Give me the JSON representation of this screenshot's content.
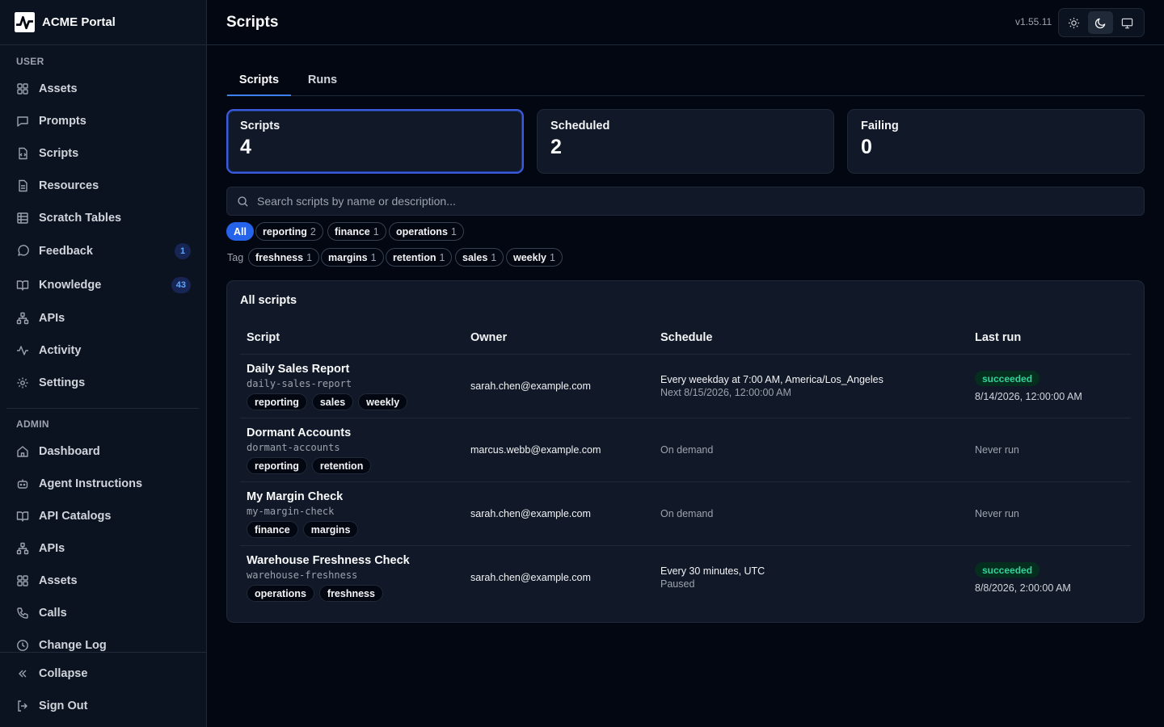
{
  "brand": {
    "name": "ACME Portal",
    "logo_icon": "pulse-logo-icon"
  },
  "sidebar": {
    "user_label": "USER",
    "user_items": [
      {
        "label": "Assets",
        "icon": "grid-icon"
      },
      {
        "label": "Prompts",
        "icon": "message-square-icon"
      },
      {
        "label": "Scripts",
        "icon": "file-code-icon"
      },
      {
        "label": "Resources",
        "icon": "file-icon"
      },
      {
        "label": "Scratch Tables",
        "icon": "table-icon"
      },
      {
        "label": "Feedback",
        "icon": "message-circle-icon",
        "badge": "1"
      },
      {
        "label": "Knowledge",
        "icon": "book-open-icon",
        "badge": "43"
      },
      {
        "label": "APIs",
        "icon": "network-icon"
      },
      {
        "label": "Activity",
        "icon": "activity-icon"
      },
      {
        "label": "Settings",
        "icon": "gear-icon"
      }
    ],
    "admin_label": "ADMIN",
    "admin_items": [
      {
        "label": "Dashboard",
        "icon": "home-icon"
      },
      {
        "label": "Agent Instructions",
        "icon": "bot-icon"
      },
      {
        "label": "API Catalogs",
        "icon": "book-open-icon"
      },
      {
        "label": "APIs",
        "icon": "network-icon"
      },
      {
        "label": "Assets",
        "icon": "grid-icon"
      },
      {
        "label": "Calls",
        "icon": "phone-icon"
      },
      {
        "label": "Change Log",
        "icon": "clock-icon"
      }
    ],
    "collapse_label": "Collapse",
    "signout_label": "Sign Out"
  },
  "header": {
    "title": "Scripts",
    "version": "v1.55.11",
    "theme_options": [
      "light-sun-icon",
      "dark-moon-icon",
      "system-monitor-icon"
    ],
    "active_theme": "dark"
  },
  "tabs": [
    {
      "label": "Scripts",
      "active": true
    },
    {
      "label": "Runs",
      "active": false
    }
  ],
  "stats": [
    {
      "label": "Scripts",
      "value": "4"
    },
    {
      "label": "Scheduled",
      "value": "2"
    },
    {
      "label": "Failing",
      "value": "0"
    }
  ],
  "search": {
    "placeholder": "Search scripts by name or description...",
    "value": ""
  },
  "filters": {
    "all_label": "All",
    "row1": [
      {
        "label": "reporting",
        "count": "2"
      },
      {
        "label": "finance",
        "count": "1"
      },
      {
        "label": "operations",
        "count": "1"
      }
    ],
    "tag_label": "Tag",
    "row2": [
      {
        "label": "freshness",
        "count": "1"
      },
      {
        "label": "margins",
        "count": "1"
      },
      {
        "label": "retention",
        "count": "1"
      },
      {
        "label": "sales",
        "count": "1"
      },
      {
        "label": "weekly",
        "count": "1"
      }
    ]
  },
  "table": {
    "title": "All scripts",
    "columns": [
      "Script",
      "Owner",
      "Schedule",
      "Last run"
    ],
    "rows": [
      {
        "name": "Daily Sales Report",
        "slug": "daily-sales-report",
        "tags": [
          "reporting",
          "sales",
          "weekly"
        ],
        "owner": "sarah.chen@example.com",
        "schedule": "Every weekday at 7:00 AM, America/Los_Angeles",
        "schedule_sub": "Next 8/15/2026, 12:00:00 AM",
        "last_status": "succeeded",
        "last_time": "8/14/2026, 12:00:00 AM"
      },
      {
        "name": "Dormant Accounts",
        "slug": "dormant-accounts",
        "tags": [
          "reporting",
          "retention"
        ],
        "owner": "marcus.webb@example.com",
        "schedule": "On demand",
        "schedule_sub": "",
        "last_status": "",
        "last_time": "Never run"
      },
      {
        "name": "My Margin Check",
        "slug": "my-margin-check",
        "tags": [
          "finance",
          "margins"
        ],
        "owner": "sarah.chen@example.com",
        "schedule": "On demand",
        "schedule_sub": "",
        "last_status": "",
        "last_time": "Never run"
      },
      {
        "name": "Warehouse Freshness Check",
        "slug": "warehouse-freshness",
        "tags": [
          "operations",
          "freshness"
        ],
        "owner": "sarah.chen@example.com",
        "schedule": "Every 30 minutes, UTC",
        "schedule_sub": "Paused",
        "last_status": "succeeded",
        "last_time": "8/8/2026, 2:00:00 AM"
      }
    ]
  },
  "colors": {
    "accent": "#2563eb",
    "success": "#34d399",
    "background": "#030712",
    "card": "#111827"
  }
}
